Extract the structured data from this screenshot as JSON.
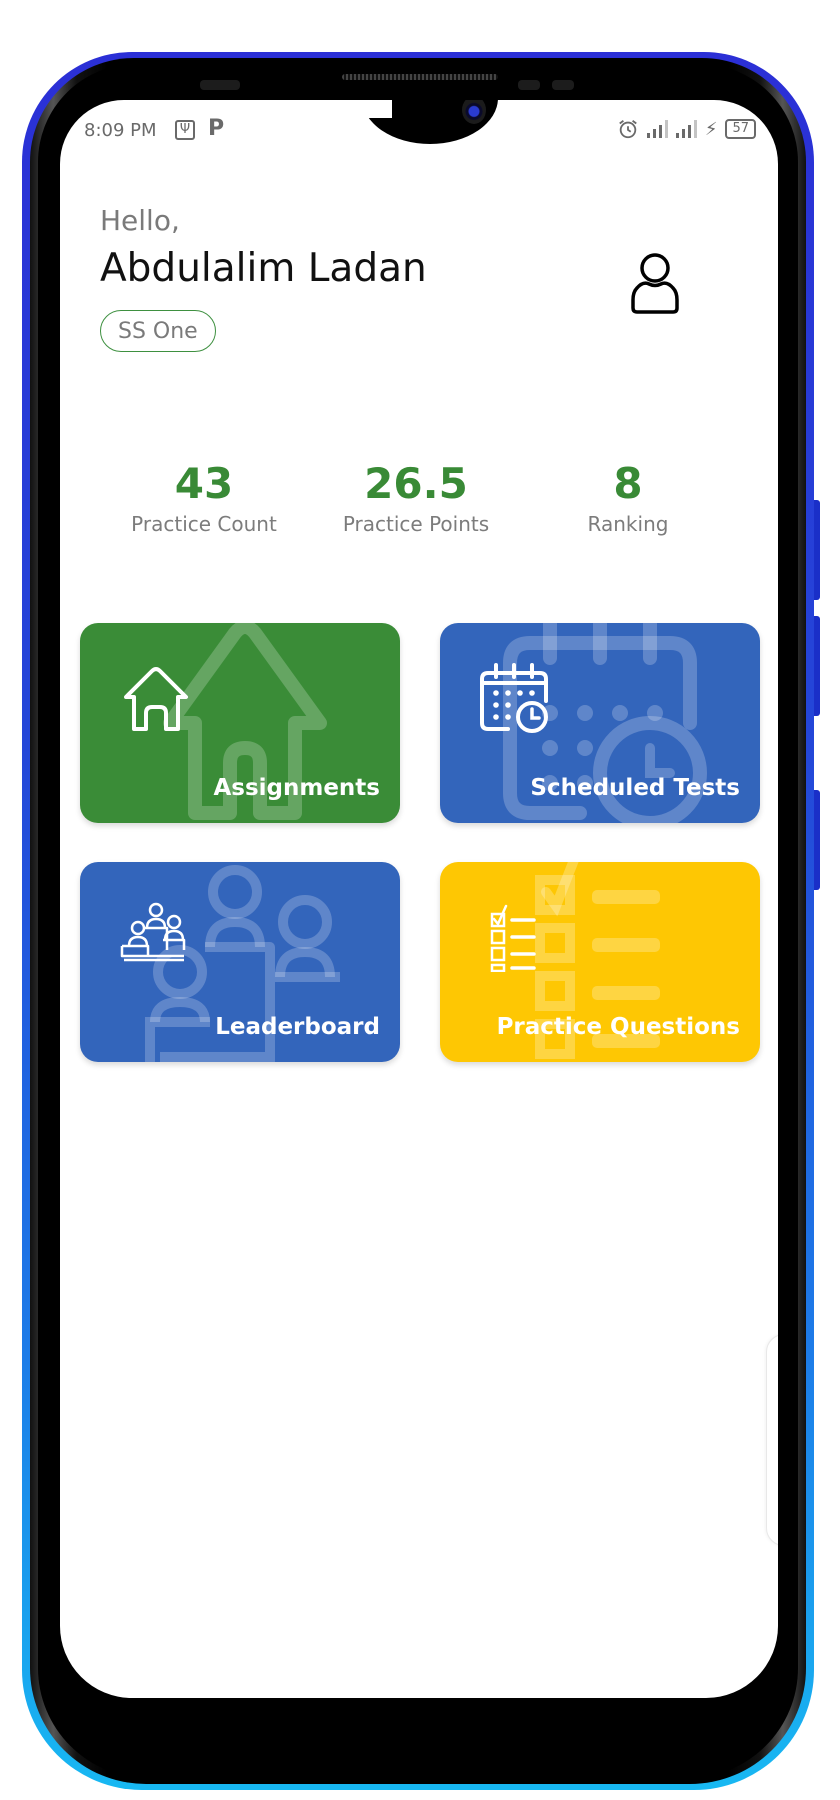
{
  "status_bar": {
    "time": "8:09 PM",
    "left_icons": [
      "usb-debug-icon",
      "parking-p-icon"
    ],
    "right_icons": [
      "alarm-icon",
      "signal-icon",
      "signal-icon",
      "charging-bolt-icon",
      "battery-icon"
    ],
    "battery_level": "57"
  },
  "header": {
    "greeting": "Hello,",
    "user_name": "Abdulalim Ladan",
    "class_badge": "SS One",
    "profile_icon": "user-profile-icon"
  },
  "stats": [
    {
      "value": "43",
      "label": "Practice Count"
    },
    {
      "value": "26.5",
      "label": "Practice Points"
    },
    {
      "value": "8",
      "label": "Ranking"
    }
  ],
  "menu": [
    {
      "label": "Assignments",
      "icon": "house-icon",
      "color": "#3a8c37"
    },
    {
      "label": "Scheduled Tests",
      "icon": "calendar-clock-icon",
      "color": "#3365bb"
    },
    {
      "label": "Leaderboard",
      "icon": "podium-people-icon",
      "color": "#3365bb"
    },
    {
      "label": "Practice Questions",
      "icon": "checklist-icon",
      "color": "#fec703"
    }
  ],
  "colors": {
    "accent_green": "#398a36",
    "frame_blue": "#2447d8",
    "frame_cyan": "#18b8f2"
  }
}
